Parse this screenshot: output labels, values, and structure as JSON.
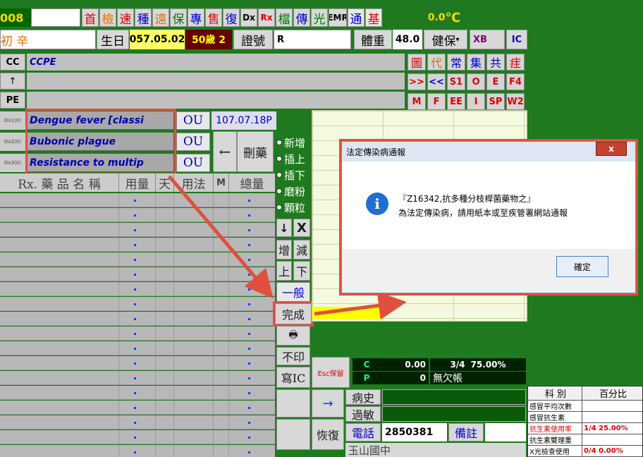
{
  "header": {
    "id_fragment": "008",
    "title_prefix": "",
    "name_fragment": "初 辛",
    "birth_label": "生日",
    "birth_value": "057.05.02",
    "age_value": "50歲 2",
    "cert_label": "證號",
    "cert_value": "R",
    "weight_label": "體重",
    "weight_value": "48.0",
    "insurance": "健保",
    "xb": "XB",
    "ic": "IC",
    "temp_value": "0.0",
    "temp_unit": "℃"
  },
  "top_buttons": [
    "首",
    "檢",
    "速",
    "種",
    "遠",
    "保",
    "專",
    "售",
    "復",
    "Dx",
    "Rx",
    "檔",
    "傳",
    "光",
    "EMR",
    "通",
    "基"
  ],
  "cc": {
    "label": "CC",
    "value": "CCPE",
    "row2": "↑",
    "row3": "PE"
  },
  "right_buttons": [
    [
      "圖",
      "代",
      "常",
      "集",
      "共",
      "疰"
    ],
    [
      ">>",
      "<<",
      "S1",
      "O",
      "E",
      "F4"
    ],
    [
      "M",
      "F",
      "EE",
      "I",
      "SP",
      "W2"
    ]
  ],
  "diagnoses": [
    {
      "label": "Dx1(0)",
      "text": "Dengue fever [classi",
      "tag": "OU",
      "date": "107.07.18P"
    },
    {
      "label": "Dx2(0)",
      "text": "Bubonic plague",
      "tag": "OU"
    },
    {
      "label": "Dx3(0)",
      "text": "Resistance to multip",
      "tag": "OU"
    }
  ],
  "arrow_left": "←",
  "delete_drug": "刪藥",
  "table_headers": {
    "rx": "Rx. 藥 品 名 稱",
    "dose": "用量",
    "day": "天",
    "usage": "用法",
    "m": "M",
    "total": "總量"
  },
  "radios": [
    "新增",
    "插上",
    "插下",
    "磨粉",
    "顆粒"
  ],
  "mid_buttons": {
    "down": "↓",
    "x": "X",
    "inc": "增",
    "dec": "減",
    "up": "上",
    "dn": "下",
    "general": "一般",
    "done": "完成",
    "noprint": "不印",
    "writeic": "寫IC",
    "esc": "Esc保留",
    "restore": "恢復",
    "arrow": "→"
  },
  "status": {
    "c": "C",
    "p": "P",
    "c_val": "0.00",
    "ratio": "3/4",
    "pct": "75.00%",
    "p_val": "0",
    "owe": "無欠帳"
  },
  "history": {
    "illness": "病史",
    "allergy": "過敏",
    "phone_label": "電話",
    "phone": "2850381",
    "remark": "備註",
    "school": "玉山國中"
  },
  "dialog": {
    "title": "法定傳染病通報",
    "line1": "『Z16342,抗多種分枝桿菌藥物之』",
    "line2": "為法定傳染病，請用紙本或至疾管署網站通報",
    "ok": "確定",
    "close": "x"
  },
  "stats": {
    "h1": "科 別",
    "h2": "百分比",
    "rows": [
      [
        "感冒平均次數",
        ""
      ],
      [
        "感冒抗生素",
        ""
      ],
      [
        "抗生素使用率",
        "1/4 25.00%"
      ],
      [
        "抗生素雙理重",
        ""
      ],
      [
        "X光檢查使用",
        "0/4 0.00%"
      ]
    ]
  },
  "colors": {
    "app_bg": "#1f7a1f",
    "highlight_red": "#e0503c",
    "done_yellow": "#ffff00"
  }
}
